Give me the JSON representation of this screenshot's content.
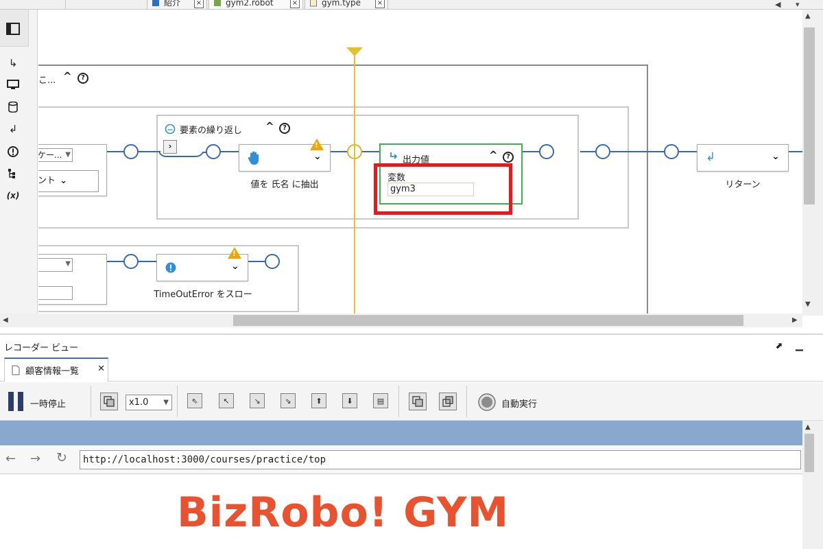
{
  "tabs": [
    {
      "label": "紹介",
      "icon": "home-icon"
    },
    {
      "label": "gym2.robot",
      "icon": "robot-icon"
    },
    {
      "label": "gym.type",
      "icon": "document-icon"
    }
  ],
  "left_toolbar": [
    "panel-toggle-icon",
    "step-arrow-icon",
    "monitor-icon",
    "database-icon",
    "return-icon",
    "error-icon",
    "tree-icon",
    "variable-icon"
  ],
  "flow": {
    "outer_group_label": "こ...",
    "loop_group_label": "要素の繰り返し",
    "left_dropdown_text": "ケー...",
    "left_field_text": "ント",
    "extract_step_caption": "値を 氏名 に抽出",
    "output_step": {
      "title": "出力値",
      "variable_label": "変数",
      "variable_value": "gym3"
    },
    "return_step_caption": "リターン",
    "throw_step_caption": "TimeOutError をスロー"
  },
  "recorder": {
    "title": "レコーダー ビュー",
    "tab_label": "顧客情報一覧",
    "pause_label": "一時停止",
    "speed_value": "x1.0",
    "auto_run_label": "自動実行",
    "url": "http://localhost:3000/courses/practice/top",
    "logo_text": "BizRobo! GYM"
  },
  "colors": {
    "wire": "#3a68b0",
    "highlight_red": "#e8181f",
    "step_green": "#3cb44b",
    "timeline_yellow": "#e4c02a",
    "logo_orange": "#e8522f"
  }
}
